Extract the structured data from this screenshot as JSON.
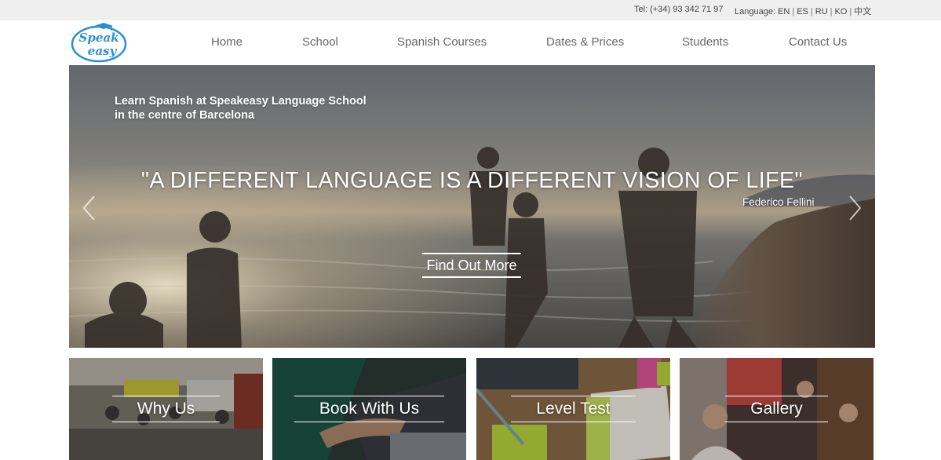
{
  "topbar": {
    "tel": "Tel: (+34) 93 342 71 97",
    "language_label": "Language:",
    "languages": [
      "EN",
      "ES",
      "RU",
      "KO",
      "中文"
    ]
  },
  "logo": {
    "line1": "Speak",
    "line2": "easy"
  },
  "nav": [
    "Home",
    "School",
    "Spanish Courses",
    "Dates & Prices",
    "Students",
    "Contact Us"
  ],
  "hero": {
    "intro_line1": "Learn Spanish at Speakeasy Language School",
    "intro_line2": "in the centre of Barcelona",
    "quote": "\"A DIFFERENT LANGUAGE IS A DIFFERENT VISION OF LIFE\"",
    "author": "Federico Fellini",
    "cta": "Find Out More"
  },
  "tiles": [
    "Why Us",
    "Book With Us",
    "Level Test",
    "Gallery"
  ],
  "icons": {
    "prev": "chevron-left-icon",
    "next": "chevron-right-icon"
  },
  "colors": {
    "topbar_bg": "#efefef",
    "nav_text": "#666666",
    "logo_blue": "#2b8fd6"
  }
}
